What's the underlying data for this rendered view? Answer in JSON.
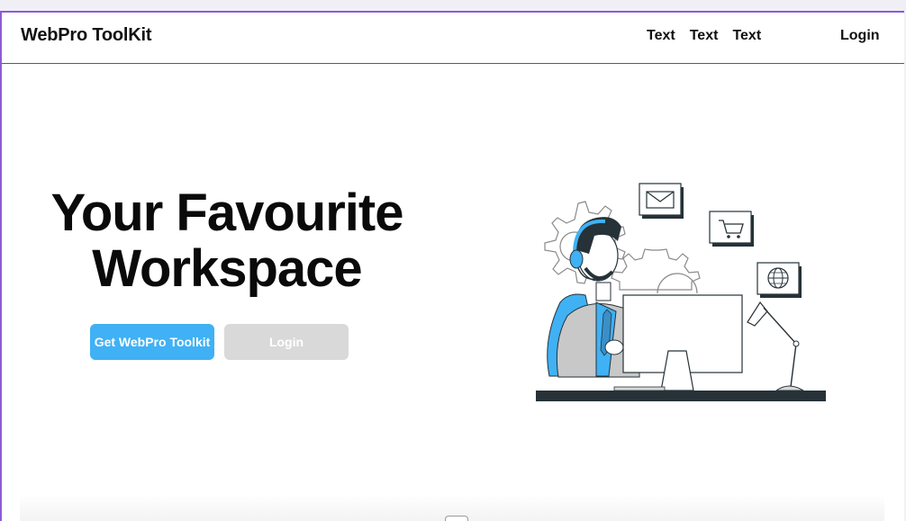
{
  "navbar": {
    "brand": "WebPro ToolKit",
    "links": [
      "Text",
      "Text",
      "Text"
    ],
    "login": "Login"
  },
  "hero": {
    "title_line1": "Your Favourite",
    "title_line2": "Workspace",
    "primary_button": "Get WebPro Toolkit",
    "secondary_button": "Login"
  },
  "colors": {
    "accent": "#3fb1f4",
    "secondary_button": "#d9d9d9",
    "frame_border": "#8d5ad8",
    "dark": "#263238"
  },
  "illustration": {
    "icons": [
      "envelope-icon",
      "shopping-cart-icon",
      "globe-icon",
      "gear-icon",
      "headset-icon",
      "desk-lamp-icon",
      "monitor-icon"
    ]
  }
}
